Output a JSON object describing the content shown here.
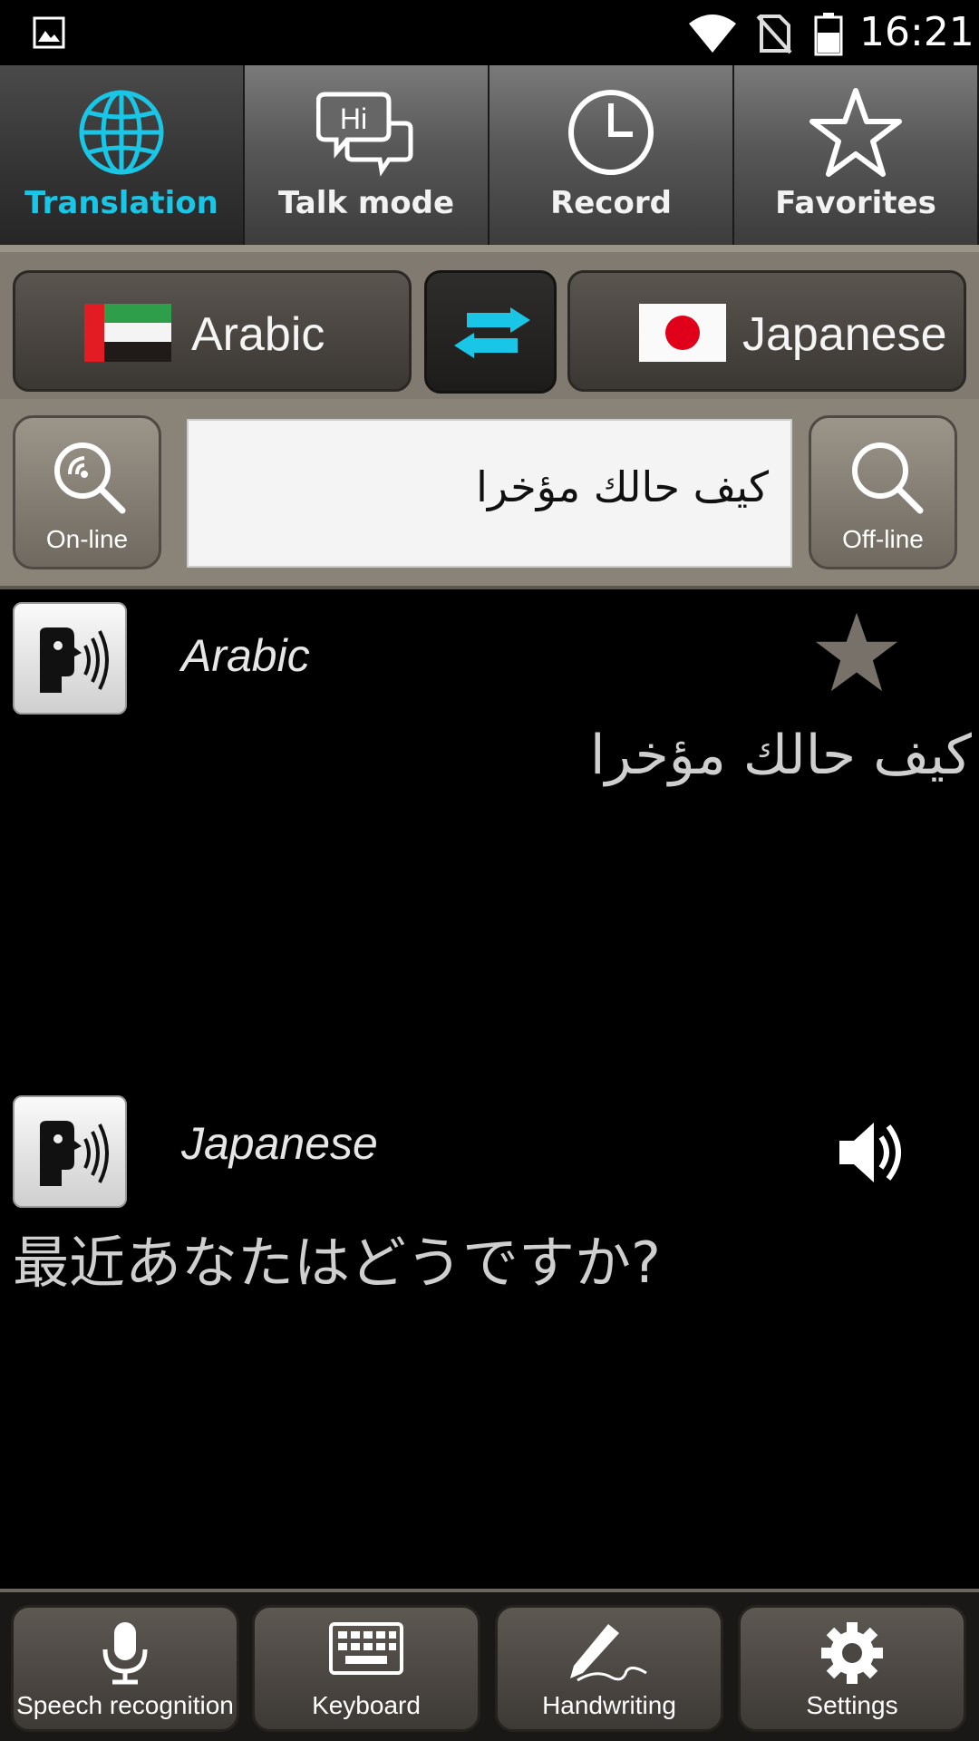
{
  "status_bar": {
    "time": "16:21"
  },
  "tabs": [
    {
      "label": "Translation",
      "active": true
    },
    {
      "label": "Talk mode",
      "active": false
    },
    {
      "label": "Record",
      "active": false
    },
    {
      "label": "Favorites",
      "active": false
    }
  ],
  "language_bar": {
    "source_language": "Arabic",
    "target_language": "Japanese"
  },
  "input": {
    "online_label": "On-line",
    "offline_label": "Off-line",
    "value": "كيف حالك مؤخرا"
  },
  "results": {
    "source": {
      "language": "Arabic",
      "text": "كيف حالك مؤخرا"
    },
    "target": {
      "language": "Japanese",
      "text": "最近あなたはどうですか?"
    }
  },
  "toolbar": {
    "speech_label": "Speech recognition",
    "keyboard_label": "Keyboard",
    "handwriting_label": "Handwriting",
    "settings_label": "Settings"
  },
  "colors": {
    "accent": "#19c6e6",
    "favorite_star": "#77716a"
  }
}
